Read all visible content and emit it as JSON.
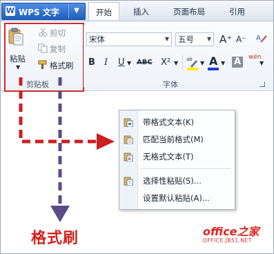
{
  "app": {
    "menu_button": "WPS 文字",
    "dropdown_arrow": "▼"
  },
  "tabs": [
    {
      "label": "开始",
      "active": true
    },
    {
      "label": "插入"
    },
    {
      "label": "页面布局"
    },
    {
      "label": "引用"
    }
  ],
  "clipboard": {
    "paste_label": "粘贴",
    "cut_label": "剪切",
    "copy_label": "复制",
    "format_painter_label": "格式刷",
    "group_label": "剪贴板",
    "highlight_color": "#cc2a2a"
  },
  "font": {
    "font_name": "宋体",
    "font_size": "五号",
    "group_label": "字体",
    "bold": "B",
    "italic": "I",
    "underline": "U",
    "strikethrough": "ABC",
    "superscript": "X²",
    "grow": "A⁺",
    "shrink": "A⁻",
    "font_color": "A",
    "char_shading": "A",
    "phonetic": "wén"
  },
  "paste_menu": {
    "items": [
      {
        "label": "带格式文本(K)",
        "icon": "paste-keep-format-icon"
      },
      {
        "label": "匹配当前格式(M)",
        "icon": "paste-match-format-icon"
      },
      {
        "label": "无格式文本(T)",
        "icon": "paste-text-only-icon"
      },
      {
        "label": "选择性粘贴(S)...",
        "icon": "paste-special-icon"
      },
      {
        "label": "设置默认粘贴(A)..."
      }
    ]
  },
  "annotation": {
    "label": "格式刷",
    "label_color": "#d8201c",
    "arrow_red": "#cc1f1f",
    "arrow_purple": "#5b4a8a"
  },
  "watermark": {
    "brand": "office之家",
    "url": "OFFICE.JB51.NET"
  }
}
